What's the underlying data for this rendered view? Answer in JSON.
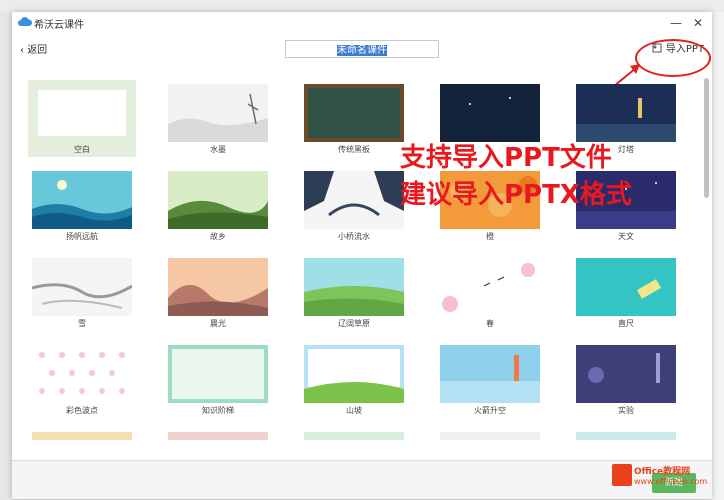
{
  "window": {
    "title": "希沃云课件",
    "minimize": "—",
    "close": "✕"
  },
  "toolbar": {
    "back_label": "返回",
    "courseware_name": "未命名课件",
    "import_label": "导入PPT"
  },
  "templates": [
    {
      "label": "空白",
      "theme": "blank",
      "selected": true
    },
    {
      "label": "水墨",
      "theme": "ink"
    },
    {
      "label": "传统黑板",
      "theme": "blackboard"
    },
    {
      "label": "",
      "theme": "night"
    },
    {
      "label": "灯塔",
      "theme": "lighthouse"
    },
    {
      "label": "扬帆远航",
      "theme": "sail"
    },
    {
      "label": "故乡",
      "theme": "hometown"
    },
    {
      "label": "小桥流水",
      "theme": "bridge"
    },
    {
      "label": "橙",
      "theme": "orange"
    },
    {
      "label": "天文",
      "theme": "astronomy"
    },
    {
      "label": "雪",
      "theme": "snow"
    },
    {
      "label": "晨光",
      "theme": "dawn"
    },
    {
      "label": "辽阔草原",
      "theme": "grassland"
    },
    {
      "label": "春",
      "theme": "spring"
    },
    {
      "label": "直尺",
      "theme": "ruler"
    },
    {
      "label": "彩色波点",
      "theme": "dots"
    },
    {
      "label": "知识阶梯",
      "theme": "ladder"
    },
    {
      "label": "山坡",
      "theme": "hill"
    },
    {
      "label": "火箭升空",
      "theme": "rocket"
    },
    {
      "label": "实验",
      "theme": "lab"
    }
  ],
  "footer": {
    "new_label": "新建"
  },
  "annotation": {
    "line1": "支持导入PPT文件",
    "line2": "建议导入PPTX格式"
  },
  "watermark": {
    "brand": "Office教程网",
    "url": "www.office26.com"
  },
  "colors": {
    "accent": "#5cb85c",
    "annotation_red": "#e8191e",
    "selected_card": "#e4eedc"
  }
}
